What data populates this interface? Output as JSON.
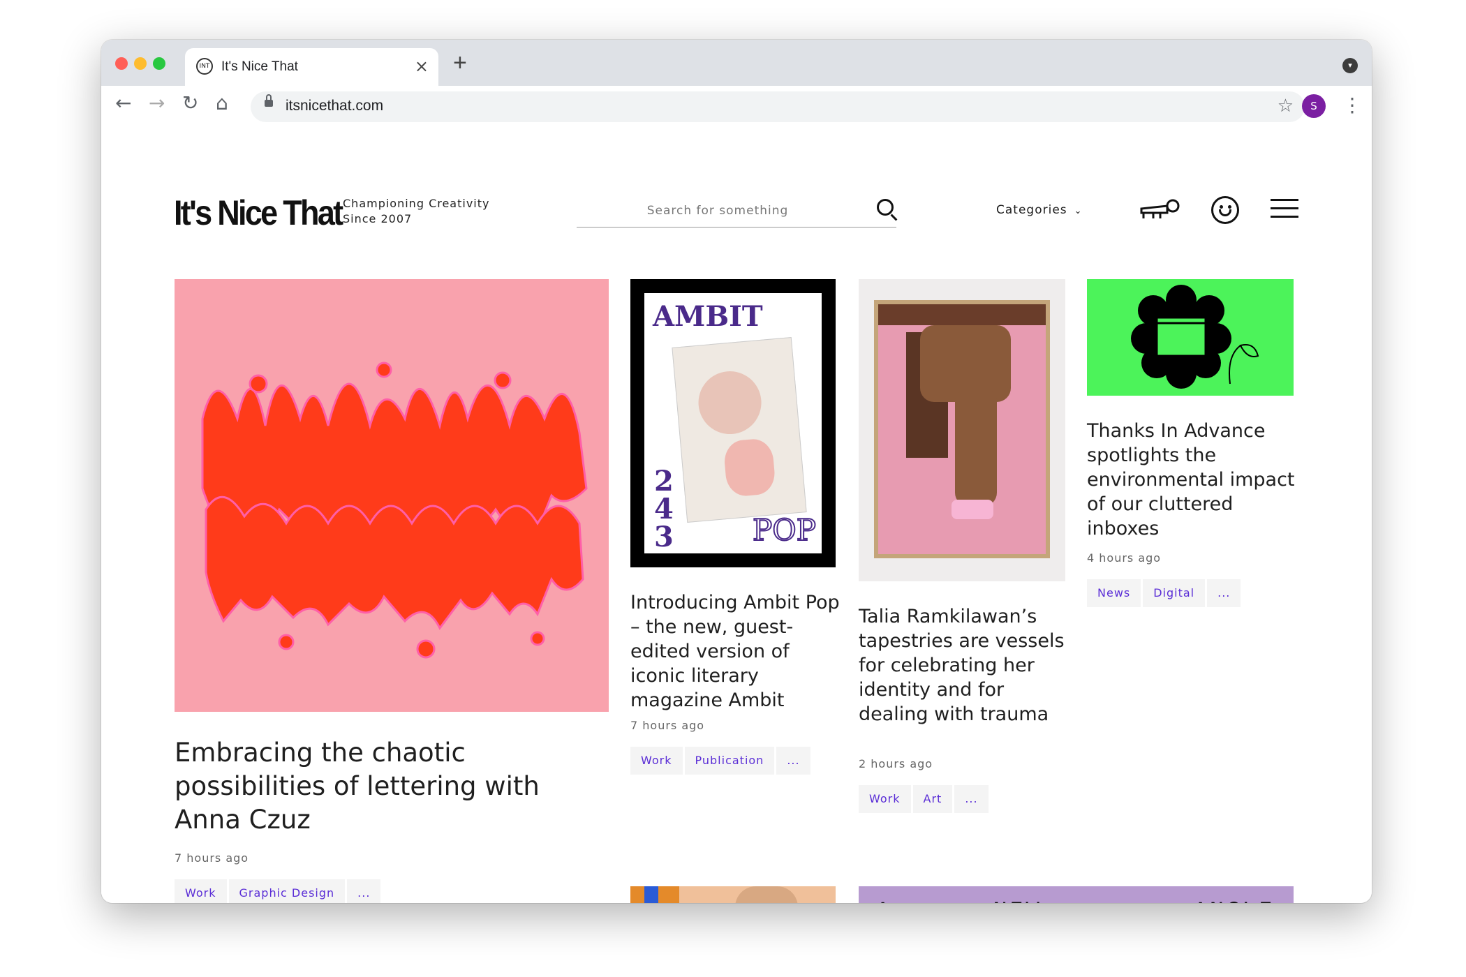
{
  "browser": {
    "tab_title": "It's Nice That",
    "favicon_text": "INT",
    "url": "itsnicethat.com",
    "profile_initial": "S",
    "colors": {
      "close": "#ff5f57",
      "minimize": "#febc2e",
      "zoom": "#28c840",
      "avatar": "#7b1fa2"
    }
  },
  "header": {
    "logo": "It's Nice That",
    "tagline_line1": "Championing Creativity",
    "tagline_line2": "Since 2007",
    "search_placeholder": "Search for something",
    "categories_label": "Categories"
  },
  "articles": [
    {
      "title": "Embracing the chaotic possibilities of lettering with Anna Czuz",
      "time": "7 hours ago",
      "tags": [
        "Work",
        "Graphic Design",
        "..."
      ]
    },
    {
      "title": "Introducing Ambit Pop – the new, guest-edited version of iconic literary magazine Ambit",
      "time": "7 hours ago",
      "tags": [
        "Work",
        "Publication",
        "..."
      ],
      "cover_title": "AMBIT",
      "cover_number": "243",
      "cover_pop": "POP"
    },
    {
      "title": "Talia Ramkilawan’s tapestries are vessels for celebrating her identity and for dealing with trauma",
      "time": "2 hours ago",
      "tags": [
        "Work",
        "Art",
        "..."
      ]
    },
    {
      "title": "Thanks In Advance spotlights the environmental impact of our cluttered inboxes",
      "time": "4 hours ago",
      "tags": [
        "News",
        "Digital",
        "..."
      ]
    }
  ],
  "bottom_banner": {
    "words": [
      "A",
      "NEW",
      "ANGLE"
    ]
  },
  "accent": {
    "tag_text": "#5a2dd6",
    "pink_bg": "#f9a2ad",
    "green_bg": "#4cf35a",
    "lilac_bg": "#b79bd0"
  }
}
